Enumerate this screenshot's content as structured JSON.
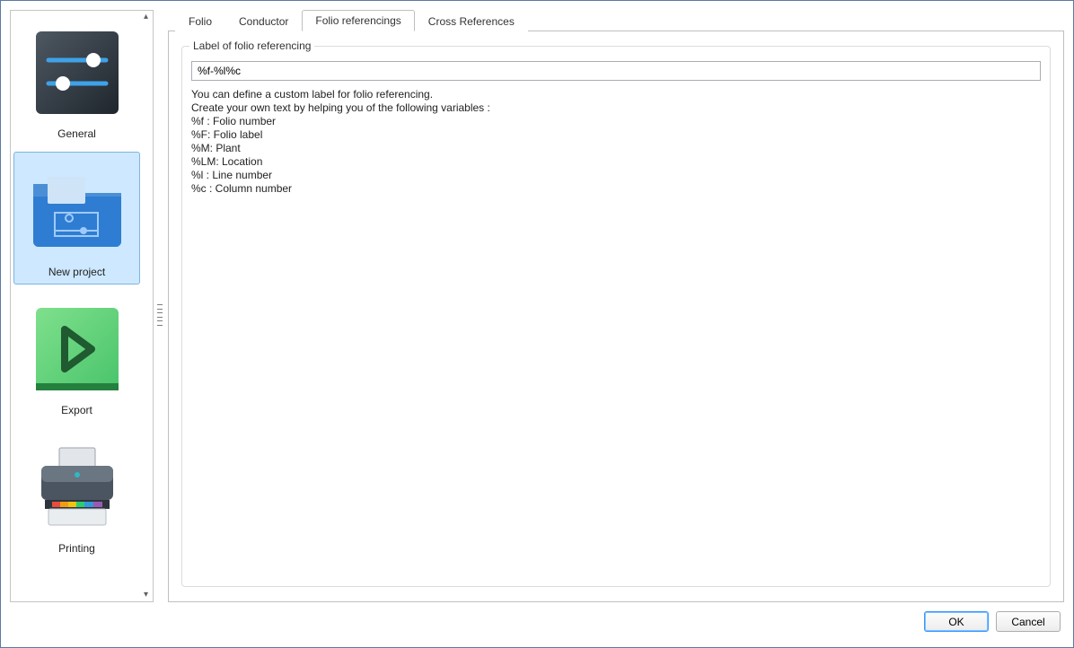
{
  "sidebar": {
    "items": [
      {
        "label": "General"
      },
      {
        "label": "New project"
      },
      {
        "label": "Export"
      },
      {
        "label": "Printing"
      }
    ]
  },
  "tabs": [
    {
      "label": "Folio"
    },
    {
      "label": "Conductor"
    },
    {
      "label": "Folio referencings"
    },
    {
      "label": "Cross References"
    }
  ],
  "group": {
    "title": "Label of folio referencing",
    "input_value": "%f-%l%c",
    "help": "You can define a custom label for folio referencing.\nCreate your own text by helping you of the following variables :\n%f : Folio number\n%F: Folio label\n%M: Plant\n%LM: Location\n%l : Line number\n%c : Column number"
  },
  "buttons": {
    "ok": "OK",
    "cancel": "Cancel"
  }
}
